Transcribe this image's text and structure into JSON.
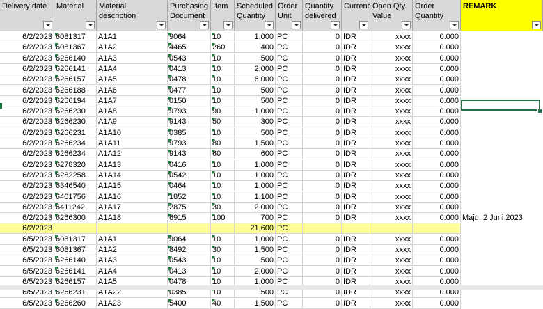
{
  "columns": [
    {
      "key": "date",
      "label": "Delivery date"
    },
    {
      "key": "material",
      "label": "Material"
    },
    {
      "key": "desc",
      "label": "Material description"
    },
    {
      "key": "po",
      "label": "Purchasing Document"
    },
    {
      "key": "item",
      "label": "Item"
    },
    {
      "key": "sched",
      "label": "Scheduled Quantity"
    },
    {
      "key": "unit",
      "label": "Order Unit"
    },
    {
      "key": "deliv",
      "label": "Quantity delivered"
    },
    {
      "key": "curr",
      "label": "Currency"
    },
    {
      "key": "openval",
      "label": "Open Qty. Value"
    },
    {
      "key": "orderqty",
      "label": "Order Quantity"
    },
    {
      "key": "remark",
      "label": "REMARK"
    }
  ],
  "rows": [
    {
      "date": "6/2/2023",
      "material": "6081317",
      "desc": "A1A1",
      "po": "9064",
      "item": "10",
      "sched": "1,000",
      "unit": "PC",
      "deliv": "0",
      "curr": "IDR",
      "openval": "xxxx",
      "orderqty": "0.000",
      "remark": ""
    },
    {
      "date": "6/2/2023",
      "material": "6081367",
      "desc": "A1A2",
      "po": "4465",
      "item": "260",
      "sched": "400",
      "unit": "PC",
      "deliv": "0",
      "curr": "IDR",
      "openval": "xxxx",
      "orderqty": "0.000",
      "remark": ""
    },
    {
      "date": "6/2/2023",
      "material": "6266140",
      "desc": "A1A3",
      "po": "0543",
      "item": "10",
      "sched": "500",
      "unit": "PC",
      "deliv": "0",
      "curr": "IDR",
      "openval": "xxxx",
      "orderqty": "0.000",
      "remark": ""
    },
    {
      "date": "6/2/2023",
      "material": "6266141",
      "desc": "A1A4",
      "po": "0413",
      "item": "10",
      "sched": "2,000",
      "unit": "PC",
      "deliv": "0",
      "curr": "IDR",
      "openval": "xxxx",
      "orderqty": "0.000",
      "remark": ""
    },
    {
      "date": "6/2/2023",
      "material": "6266157",
      "desc": "A1A5",
      "po": "0478",
      "item": "10",
      "sched": "6,000",
      "unit": "PC",
      "deliv": "0",
      "curr": "IDR",
      "openval": "xxxx",
      "orderqty": "0.000",
      "remark": ""
    },
    {
      "date": "6/2/2023",
      "material": "6266188",
      "desc": "A1A6",
      "po": "0477",
      "item": "10",
      "sched": "500",
      "unit": "PC",
      "deliv": "0",
      "curr": "IDR",
      "openval": "xxxx",
      "orderqty": "0.000",
      "remark": ""
    },
    {
      "date": "6/2/2023",
      "material": "6266194",
      "desc": "A1A7",
      "po": "0150",
      "item": "10",
      "sched": "500",
      "unit": "PC",
      "deliv": "0",
      "curr": "IDR",
      "openval": "xxxx",
      "orderqty": "0.000",
      "remark": ""
    },
    {
      "date": "6/2/2023",
      "material": "6266230",
      "desc": "A1A8",
      "po": "9793",
      "item": "90",
      "sched": "1,000",
      "unit": "PC",
      "deliv": "0",
      "curr": "IDR",
      "openval": "xxxx",
      "orderqty": "0.000",
      "remark": ""
    },
    {
      "date": "6/2/2023",
      "material": "6266230",
      "desc": "A1A9",
      "po": "9143",
      "item": "50",
      "sched": "300",
      "unit": "PC",
      "deliv": "0",
      "curr": "IDR",
      "openval": "xxxx",
      "orderqty": "0.000",
      "remark": ""
    },
    {
      "date": "6/2/2023",
      "material": "6266231",
      "desc": "A1A10",
      "po": "0385",
      "item": "10",
      "sched": "500",
      "unit": "PC",
      "deliv": "0",
      "curr": "IDR",
      "openval": "xxxx",
      "orderqty": "0.000",
      "remark": ""
    },
    {
      "date": "6/2/2023",
      "material": "6266234",
      "desc": "A1A11",
      "po": "9793",
      "item": "80",
      "sched": "1,500",
      "unit": "PC",
      "deliv": "0",
      "curr": "IDR",
      "openval": "xxxx",
      "orderqty": "0.000",
      "remark": ""
    },
    {
      "date": "6/2/2023",
      "material": "6266234",
      "desc": "A1A12",
      "po": "9143",
      "item": "60",
      "sched": "600",
      "unit": "PC",
      "deliv": "0",
      "curr": "IDR",
      "openval": "xxxx",
      "orderqty": "0.000",
      "remark": ""
    },
    {
      "date": "6/2/2023",
      "material": "6278320",
      "desc": "A1A13",
      "po": "0416",
      "item": "10",
      "sched": "1,000",
      "unit": "PC",
      "deliv": "0",
      "curr": "IDR",
      "openval": "xxxx",
      "orderqty": "0.000",
      "remark": ""
    },
    {
      "date": "6/2/2023",
      "material": "6282258",
      "desc": "A1A14",
      "po": "0542",
      "item": "10",
      "sched": "1,000",
      "unit": "PC",
      "deliv": "0",
      "curr": "IDR",
      "openval": "xxxx",
      "orderqty": "0.000",
      "remark": ""
    },
    {
      "date": "6/2/2023",
      "material": "6346540",
      "desc": "A1A15",
      "po": "0464",
      "item": "10",
      "sched": "1,000",
      "unit": "PC",
      "deliv": "0",
      "curr": "IDR",
      "openval": "xxxx",
      "orderqty": "0.000",
      "remark": ""
    },
    {
      "date": "6/2/2023",
      "material": "6401756",
      "desc": "A1A16",
      "po": "1852",
      "item": "10",
      "sched": "1,100",
      "unit": "PC",
      "deliv": "0",
      "curr": "IDR",
      "openval": "xxxx",
      "orderqty": "0.000",
      "remark": ""
    },
    {
      "date": "6/2/2023",
      "material": "6411242",
      "desc": "A1A17",
      "po": "2875",
      "item": "30",
      "sched": "2,000",
      "unit": "PC",
      "deliv": "0",
      "curr": "IDR",
      "openval": "xxxx",
      "orderqty": "0.000",
      "remark": ""
    },
    {
      "date": "6/2/2023",
      "material": "6266300",
      "desc": "A1A18",
      "po": "6915",
      "item": "100",
      "sched": "700",
      "unit": "PC",
      "deliv": "0",
      "curr": "IDR",
      "openval": "xxxx",
      "orderqty": "0.000",
      "remark": "Maju, 2 Juni 2023"
    },
    {
      "sum": true,
      "date": "6/2/2023",
      "material": "",
      "desc": "",
      "po": "",
      "item": "",
      "sched": "21,600",
      "unit": "PC",
      "deliv": "",
      "curr": "",
      "openval": "",
      "orderqty": "",
      "remark": ""
    },
    {
      "date": "6/5/2023",
      "material": "6081317",
      "desc": "A1A1",
      "po": "9064",
      "item": "10",
      "sched": "1,000",
      "unit": "PC",
      "deliv": "0",
      "curr": "IDR",
      "openval": "xxxx",
      "orderqty": "0.000",
      "remark": ""
    },
    {
      "date": "6/5/2023",
      "material": "6081367",
      "desc": "A1A2",
      "po": "8492",
      "item": "30",
      "sched": "1,500",
      "unit": "PC",
      "deliv": "0",
      "curr": "IDR",
      "openval": "xxxx",
      "orderqty": "0.000",
      "remark": ""
    },
    {
      "date": "6/5/2023",
      "material": "6266140",
      "desc": "A1A3",
      "po": "0543",
      "item": "10",
      "sched": "500",
      "unit": "PC",
      "deliv": "0",
      "curr": "IDR",
      "openval": "xxxx",
      "orderqty": "0.000",
      "remark": ""
    },
    {
      "date": "6/5/2023",
      "material": "6266141",
      "desc": "A1A4",
      "po": "0413",
      "item": "10",
      "sched": "2,000",
      "unit": "PC",
      "deliv": "0",
      "curr": "IDR",
      "openval": "xxxx",
      "orderqty": "0.000",
      "remark": ""
    },
    {
      "date": "6/5/2023",
      "material": "6266157",
      "desc": "A1A5",
      "po": "0478",
      "item": "10",
      "sched": "1,000",
      "unit": "PC",
      "deliv": "0",
      "curr": "IDR",
      "openval": "xxxx",
      "orderqty": "0.000",
      "remark": ""
    },
    {
      "date": "6/5/2023",
      "material": "6266231",
      "desc": "A1A22",
      "po": "0385",
      "item": "10",
      "sched": "500",
      "unit": "PC",
      "deliv": "0",
      "curr": "IDR",
      "openval": "xxxx",
      "orderqty": "0.000",
      "remark": ""
    },
    {
      "date": "6/5/2023",
      "material": "6266260",
      "desc": "A1A23",
      "po": "5400",
      "item": "40",
      "sched": "1,500",
      "unit": "PC",
      "deliv": "0",
      "curr": "IDR",
      "openval": "xxxx",
      "orderqty": "0.000",
      "remark": ""
    }
  ],
  "colors": {
    "header_bg": "#d9d9d9",
    "remark_header_bg": "#ffff00",
    "sum_row_bg": "#ffff99",
    "selection": "#217346",
    "text_marker": "#1e7d3c"
  }
}
